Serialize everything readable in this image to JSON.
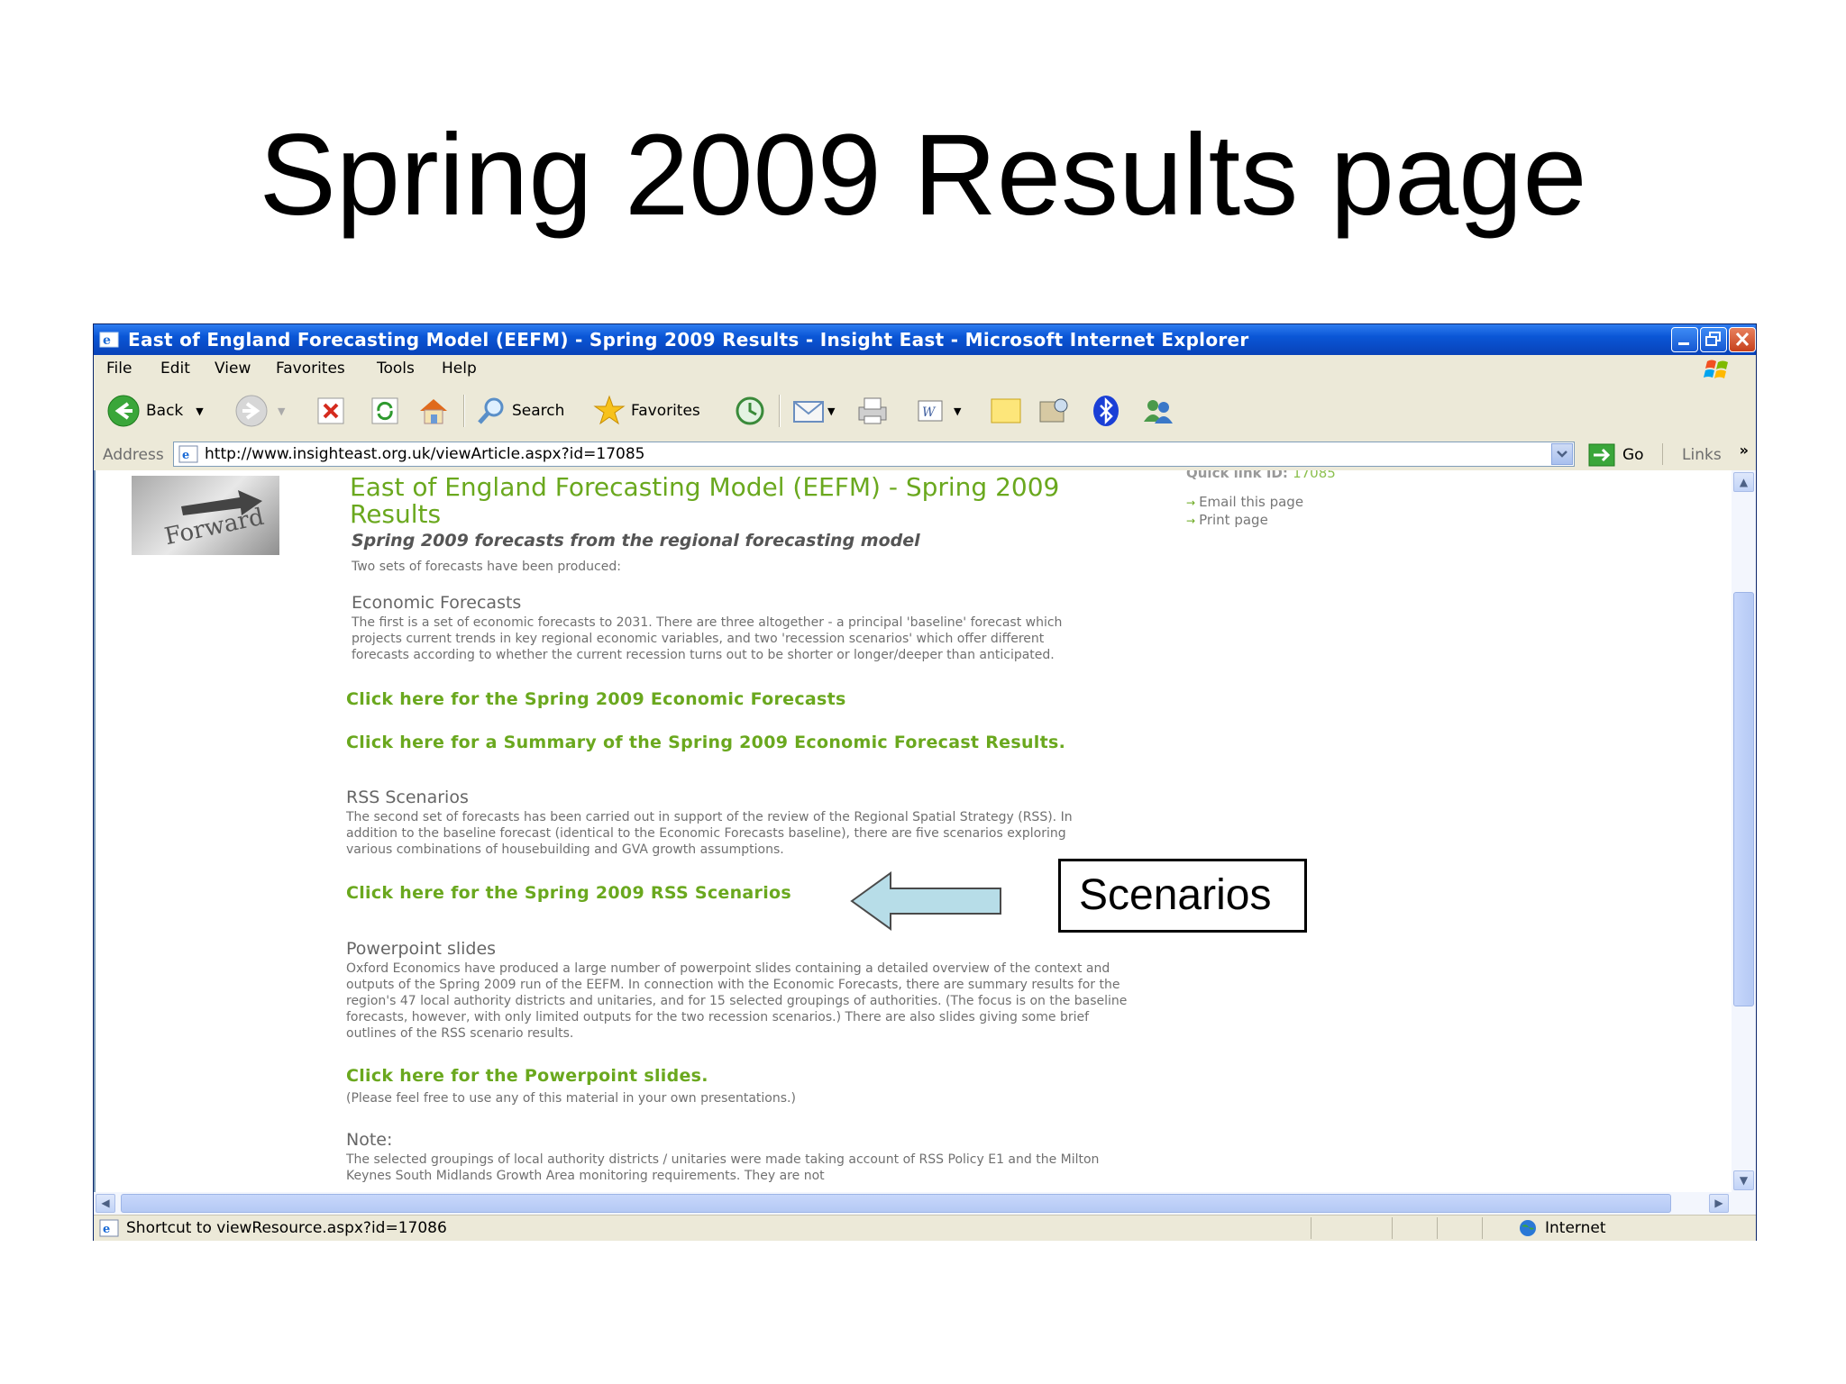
{
  "slide": {
    "title": "Spring 2009 Results page"
  },
  "window": {
    "title": "East of England Forecasting Model (EEFM) - Spring 2009 Results - Insight East - Microsoft Internet Explorer"
  },
  "menu": [
    "File",
    "Edit",
    "View",
    "Favorites",
    "Tools",
    "Help"
  ],
  "toolbar": {
    "back": "Back",
    "search": "Search",
    "favorites": "Favorites"
  },
  "address": {
    "label": "Address",
    "url": "http://www.insighteast.org.uk/viewArticle.aspx?id=17085",
    "go": "Go",
    "links": "Links"
  },
  "page": {
    "forward_img_text": "Forward",
    "heading": "East of England Forecasting Model (EEFM) - Spring 2009 Results",
    "subheading": "Spring 2009 forecasts from the regional forecasting model",
    "intro": "Two sets of forecasts have been produced:",
    "quick_link_label": "Quick link ID:",
    "quick_link_value": "17085",
    "email_link": "Email this page",
    "print_link": "Print page",
    "econ_heading": "Economic Forecasts",
    "econ_text": "The first is a set of economic forecasts to 2031. There are three altogether - a principal 'baseline' forecast which projects current trends in key regional economic variables, and two 'recession scenarios' which offer different forecasts according to whether the current recession turns out to be shorter or longer/deeper than anticipated.",
    "link_econ": "Click here for the Spring 2009 Economic Forecasts",
    "link_summary": "Click here for a Summary of the Spring 2009 Economic Forecast Results.",
    "rss_heading": "RSS Scenarios",
    "rss_text": "The second set of forecasts has been carried out in support of the review of the Regional Spatial Strategy (RSS). In addition to the baseline forecast (identical to the Economic Forecasts baseline), there are five scenarios exploring various combinations of housebuilding and GVA growth assumptions.",
    "link_rss": "Click here for the Spring 2009 RSS Scenarios",
    "ppt_heading": "Powerpoint slides",
    "ppt_text": "Oxford Economics have produced a large number of powerpoint slides containing a detailed overview of the context and outputs of the Spring 2009 run of the EEFM. In connection with the Economic Forecasts, there are summary results for the region's 47 local authority districts and unitaries, and for 15 selected groupings of authorities. (The focus is on the baseline forecasts, however, with only limited outputs for the two recession scenarios.) There are also slides giving some brief outlines of the RSS scenario results.",
    "link_ppt": "Click here for the Powerpoint slides.",
    "ppt_note": "(Please feel free to use any of this material in your own presentations.)",
    "note_heading": "Note:",
    "note_text": "The selected groupings of local authority districts / unitaries were made taking account of RSS Policy E1 and the Milton Keynes South Midlands Growth Area monitoring requirements. They are not"
  },
  "status": {
    "text": "Shortcut to viewResource.aspx?id=17086",
    "zone": "Internet"
  },
  "annotation": {
    "label": "Scenarios"
  },
  "colors": {
    "link_green": "#6aa81e",
    "titlebar_blue": "#0a56d6",
    "arrow_fill": "#b7dde8"
  }
}
